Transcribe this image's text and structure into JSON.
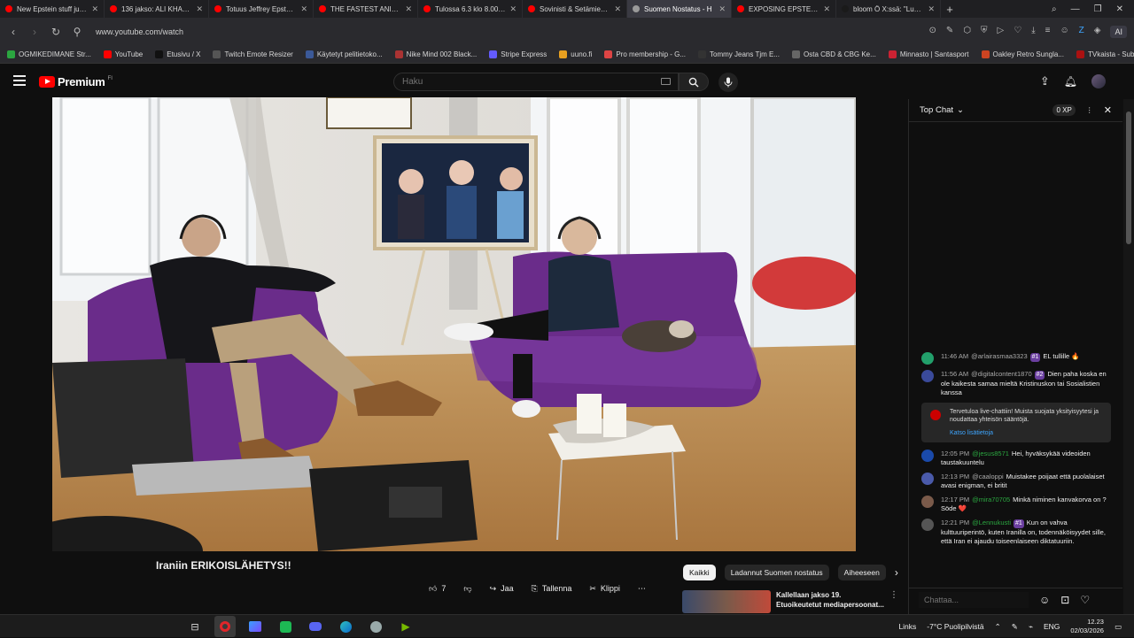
{
  "tabs": [
    {
      "title": "New Epstein stuff just dro",
      "color": "#ff0000"
    },
    {
      "title": "136 jakso: ALI KHAMENEI",
      "color": "#ff0000"
    },
    {
      "title": "Totuus Jeffrey Epsteinin K",
      "color": "#ff0000"
    },
    {
      "title": "THE FASTEST ANIMATRON",
      "color": "#ff0000"
    },
    {
      "title": "Tulossa 6.3 klo 8.00 Aleksi",
      "color": "#ff0000"
    },
    {
      "title": "Sovinisti & Setämies, jakso",
      "color": "#ff0000"
    },
    {
      "title": "Suomen Nostatus - H",
      "color": "#9a9a9a"
    },
    {
      "title": "EXPOSING EPSTEIN'S ZOR",
      "color": "#ff0000"
    },
    {
      "title": "bloom Ö X:ssä: \"Ludwig c",
      "color": "#1a1a1a"
    }
  ],
  "address": {
    "url": "www.youtube.com/watch",
    "ai_label": "AI"
  },
  "bookmarks": [
    {
      "label": "OGMIKEDIMANE Str...",
      "color": "#2ba640"
    },
    {
      "label": "YouTube",
      "color": "#ff0000"
    },
    {
      "label": "Etusivu / X",
      "color": "#111111"
    },
    {
      "label": "Twitch Emote Resizer",
      "color": "#555555"
    },
    {
      "label": "Käytetyt pelitietoko...",
      "color": "#3b5998"
    },
    {
      "label": "Nike Mind 002 Black...",
      "color": "#aa3333"
    },
    {
      "label": "Stripe Express",
      "color": "#635bff"
    },
    {
      "label": "uuno.fi",
      "color": "#e8a020"
    },
    {
      "label": "Pro membership - G...",
      "color": "#dd4444"
    },
    {
      "label": "Tommy Jeans Tjm E...",
      "color": "#333333"
    },
    {
      "label": "Osta CBD & CBG Ke...",
      "color": "#666666"
    },
    {
      "label": "Minnasto | Santasport",
      "color": "#cc2233"
    },
    {
      "label": "Oakley Retro Sungla...",
      "color": "#cc4422"
    },
    {
      "label": "TVkaista - Sub Suara",
      "color": "#aa1111"
    }
  ],
  "youtube": {
    "brand": "Premium",
    "brand_sup": "FI",
    "search_placeholder": "Haku"
  },
  "video": {
    "title": "Iraniin ERIKOISLÄHETYS!!",
    "like_count": "7",
    "share_label": "Jaa",
    "save_label": "Tallenna",
    "clip_label": "Klippi"
  },
  "chips": [
    "Kaikki",
    "Ladannut Suomen nostatus",
    "Aiheeseen"
  ],
  "recommendation": {
    "title": "Kallellaan jakso 19. Etuoikeutetut mediapersoonat..."
  },
  "chat": {
    "mode": "Top Chat",
    "xp_label": "0 XP",
    "messages": [
      {
        "time": "11:46 AM",
        "author": "@arlairasmaa3323",
        "badge": "#1",
        "text": "EL tullille 🔥",
        "avatar": "#22a06b",
        "green": false
      },
      {
        "time": "11:56 AM",
        "author": "@digitalcontent1870",
        "badge": "#2",
        "text": "Dien paha koska en ole kaikesta samaa mieltä Kristinuskon tai Sosialistien kanssa",
        "avatar": "#3a4a9a",
        "green": false
      }
    ],
    "system": {
      "text": "Tervetuloa live-chattiin! Muista suojata yksityisyytesi ja noudattaa yhteisön sääntöjä.",
      "link": "Katso lisätietoja"
    },
    "messages2": [
      {
        "time": "12:05 PM",
        "author": "@jesus8571",
        "badge": "",
        "text": "Hei, hyväksykää videoiden taustakuuntelu",
        "avatar": "#1a4aaa",
        "green": true
      },
      {
        "time": "12:13 PM",
        "author": "@caaloppi",
        "badge": "",
        "text": "Muistakee poijaat että puolalaiset avasi enigman, ei britit",
        "avatar": "#4a5aaa",
        "green": false
      },
      {
        "time": "12:17 PM",
        "author": "@mira70705",
        "badge": "",
        "text": "Minkä niminen kanvakorva on ? Söde ❤️",
        "avatar": "#7a5a4a",
        "green": true
      },
      {
        "time": "12:21 PM",
        "author": "@Lennukusti",
        "badge": "#1",
        "text": "Kun on vahva kulttuuriperintö, kuten Iranilla on, todennäköisyydet sille, että Iran ei ajaudu toiseenlaiseen diktatuuriin.",
        "avatar": "#555555",
        "green": true
      }
    ],
    "input_placeholder": "Chattaa..."
  },
  "taskbar": {
    "links_label": "Links",
    "weather": "-7°C  Puolipilvistä",
    "lang": "ENG",
    "time": "12.23",
    "date": "02/03/2026"
  }
}
